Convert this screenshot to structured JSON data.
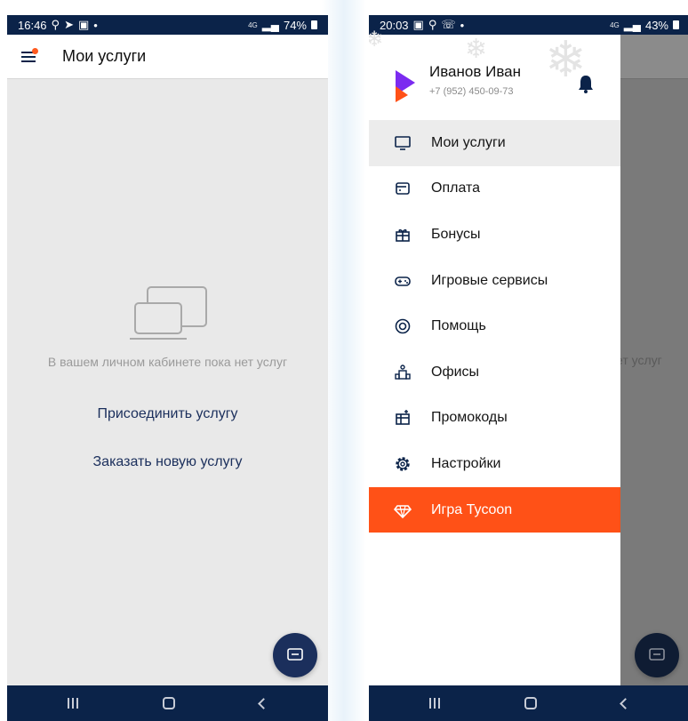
{
  "left_phone": {
    "status": {
      "time": "16:46",
      "network": "4G",
      "battery": "74%"
    },
    "app_title": "Мои услуги",
    "empty_message": "В вашем личном кабинете пока нет услуг",
    "links": {
      "connect": "Присоединить услугу",
      "order": "Заказать новую услугу"
    }
  },
  "right_phone": {
    "status": {
      "time": "20:03",
      "network": "4G",
      "battery": "43%"
    },
    "user": {
      "name": "Иванов Иван",
      "phone": "+7 (952) 450-09-73"
    },
    "background_text": "ет услуг",
    "menu": [
      {
        "label": "Мои услуги",
        "icon": "monitor-icon",
        "state": "active"
      },
      {
        "label": "Оплата",
        "icon": "wallet-icon",
        "state": "normal"
      },
      {
        "label": "Бонусы",
        "icon": "gift-icon",
        "state": "normal"
      },
      {
        "label": "Игровые сервисы",
        "icon": "gamepad-icon",
        "state": "normal"
      },
      {
        "label": "Помощь",
        "icon": "lifebuoy-icon",
        "state": "normal"
      },
      {
        "label": "Офисы",
        "icon": "office-icon",
        "state": "normal"
      },
      {
        "label": "Промокоды",
        "icon": "promo-gift-icon",
        "state": "normal"
      },
      {
        "label": "Настройки",
        "icon": "gear-icon",
        "state": "normal"
      },
      {
        "label": "Игра Tycoon",
        "icon": "diamond-icon",
        "state": "highlight"
      }
    ]
  },
  "colors": {
    "dark_blue": "#0b2349",
    "accent_orange": "#ff5117",
    "link_blue": "#1b2f5c",
    "logo_purple": "#7b2bf0"
  }
}
